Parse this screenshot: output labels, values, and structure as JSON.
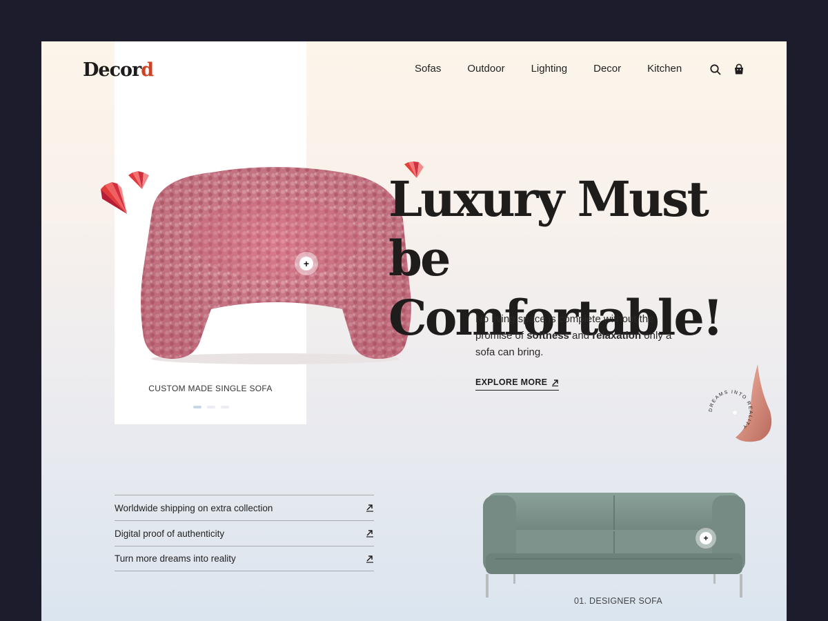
{
  "brand": {
    "logo_text": "Decor",
    "logo_accent": "d"
  },
  "nav": {
    "items": [
      {
        "label": "Sofas"
      },
      {
        "label": "Outdoor"
      },
      {
        "label": "Lighting"
      },
      {
        "label": "Decor"
      },
      {
        "label": "Kitchen"
      }
    ],
    "icons": [
      "search-icon",
      "shopping-bag-icon"
    ]
  },
  "hero": {
    "title_line1": "Luxury Must be",
    "title_line2": "Comfortable!",
    "desc_part1": "No living space is complete without the promise of ",
    "desc_bold1": "softness",
    "desc_part2": " and ",
    "desc_bold2": "relaxation",
    "desc_part3": " only a sofa can bring.",
    "cta_label": "EXPLORE MORE"
  },
  "product_card": {
    "label": "CUSTOM MADE SINGLE SOFA",
    "slider_active_index": 0,
    "slider_count": 3
  },
  "badge": {
    "circular_text": "DREAMS INTO REALITY"
  },
  "features": [
    {
      "label": "Worldwide shipping on extra collection"
    },
    {
      "label": "Digital proof of authenticity"
    },
    {
      "label": "Turn more dreams into reality"
    }
  ],
  "secondary_product": {
    "label": "01. DESIGNER SOFA"
  },
  "colors": {
    "background": "#1d1c2c",
    "pink_sofa": "#e58a9c",
    "green_sofa": "#7e958d",
    "accent_red": "#c94324",
    "text_dark": "#1f1d1d"
  }
}
